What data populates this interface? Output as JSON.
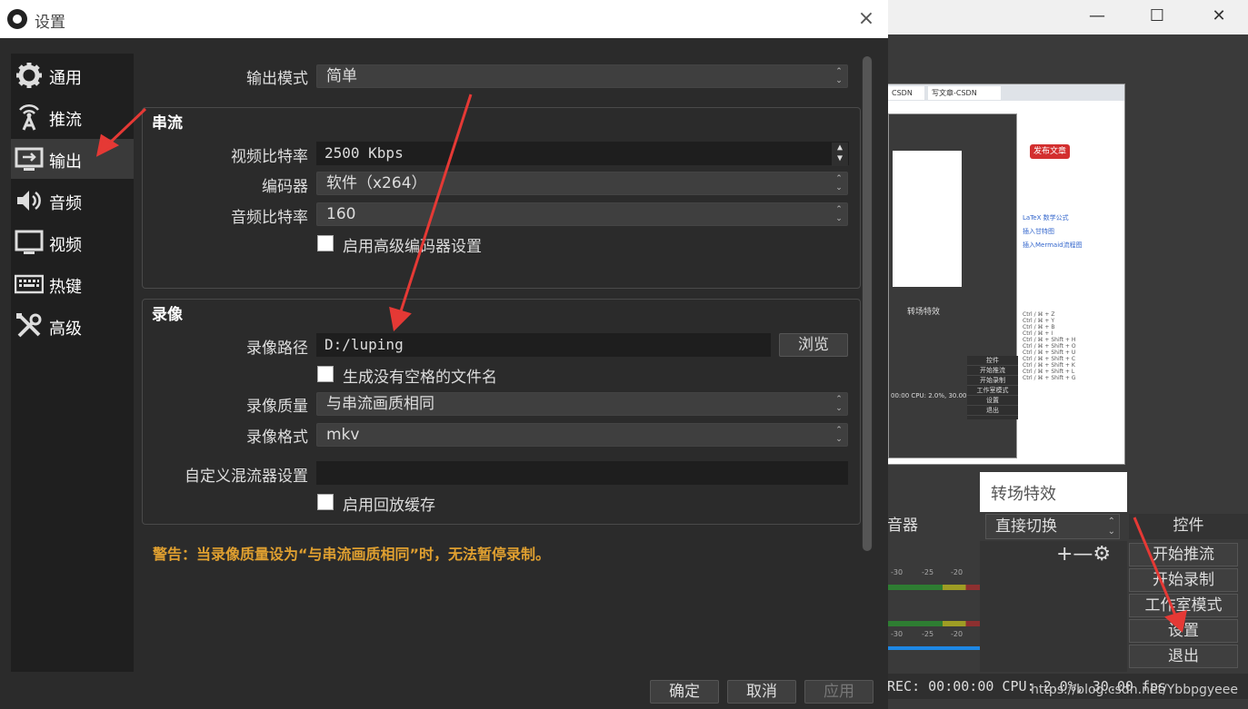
{
  "dialog": {
    "title": "设置",
    "close_icon": "×"
  },
  "nav": {
    "items": [
      {
        "label": "通用",
        "icon": "gear-icon"
      },
      {
        "label": "推流",
        "icon": "broadcast-antenna-icon"
      },
      {
        "label": "输出",
        "icon": "output-monitor-icon"
      },
      {
        "label": "音频",
        "icon": "speaker-icon"
      },
      {
        "label": "视频",
        "icon": "monitor-icon"
      },
      {
        "label": "热键",
        "icon": "keyboard-icon"
      },
      {
        "label": "高级",
        "icon": "tools-icon"
      }
    ],
    "active_index": 2
  },
  "output": {
    "mode_label": "输出模式",
    "mode_value": "简单",
    "streaming": {
      "title": "串流",
      "video_bitrate_label": "视频比特率",
      "video_bitrate_value": "2500 Kbps",
      "encoder_label": "编码器",
      "encoder_value": "软件（x264）",
      "audio_bitrate_label": "音频比特率",
      "audio_bitrate_value": "160",
      "advanced_encoder_label": "启用高级编码器设置"
    },
    "recording": {
      "title": "录像",
      "path_label": "录像路径",
      "path_value": "D:/luping",
      "browse_label": "浏览",
      "no_space_label": "生成没有空格的文件名",
      "quality_label": "录像质量",
      "quality_value": "与串流画质相同",
      "format_label": "录像格式",
      "format_value": "mkv",
      "muxer_label": "自定义混流器设置",
      "muxer_value": "",
      "replay_buffer_label": "启用回放缓存"
    },
    "warning": "警告：当录像质量设为“与串流画质相同”时，无法暂停录制。"
  },
  "buttons": {
    "ok": "确定",
    "cancel": "取消",
    "apply": "应用"
  },
  "background": {
    "window_buttons": [
      "—",
      "☐",
      "✕"
    ],
    "transition_title": "转场特效",
    "mixer_label": "音器",
    "transition_select": "直接切换",
    "tools_label": "+—⚙",
    "controls_label": "控件",
    "control_buttons": [
      "开始推流",
      "开始录制",
      "工作室模式",
      "设置",
      "退出"
    ],
    "meter_scale": [
      "-30",
      "-25",
      "-20"
    ],
    "status": "REC: 00:00:00   CPU: 2.0%, 30.00 fps",
    "watermark": "https://blog.csdn.net/Ybbpgyeee",
    "preview": {
      "tab1": "CSDN",
      "tab2": "写文章-CSDN",
      "red_button": "发布文章",
      "inner_status": "00:00   CPU: 2.0%, 30.00 fps",
      "menu": [
        "控件",
        "开始推流",
        "开始录制",
        "工作室模式",
        "设置",
        "退出"
      ],
      "shortcuts": [
        "Ctrl / ⌘ + Z",
        "Ctrl / ⌘ + Y",
        "Ctrl / ⌘ + B",
        "Ctrl / ⌘ + I",
        "Ctrl / ⌘ + Shift + H",
        "Ctrl / ⌘ + Shift + O",
        "Ctrl / ⌘ + Shift + U",
        "Ctrl / ⌘ + Shift + C",
        "Ctrl / ⌘ + Shift + K",
        "Ctrl / ⌘ + Shift + L",
        "Ctrl / ⌘ + Shift + G"
      ],
      "inner_transition": "转场特效",
      "latex_tag": "LaTeX 数学公式",
      "gantt_tag": "插入甘特图",
      "mermaid_tag": "插入Mermaid流程图"
    }
  },
  "colors": {
    "warning": "#e0a030",
    "arrow": "#e53935",
    "nav_active": "#3a3a3a"
  }
}
